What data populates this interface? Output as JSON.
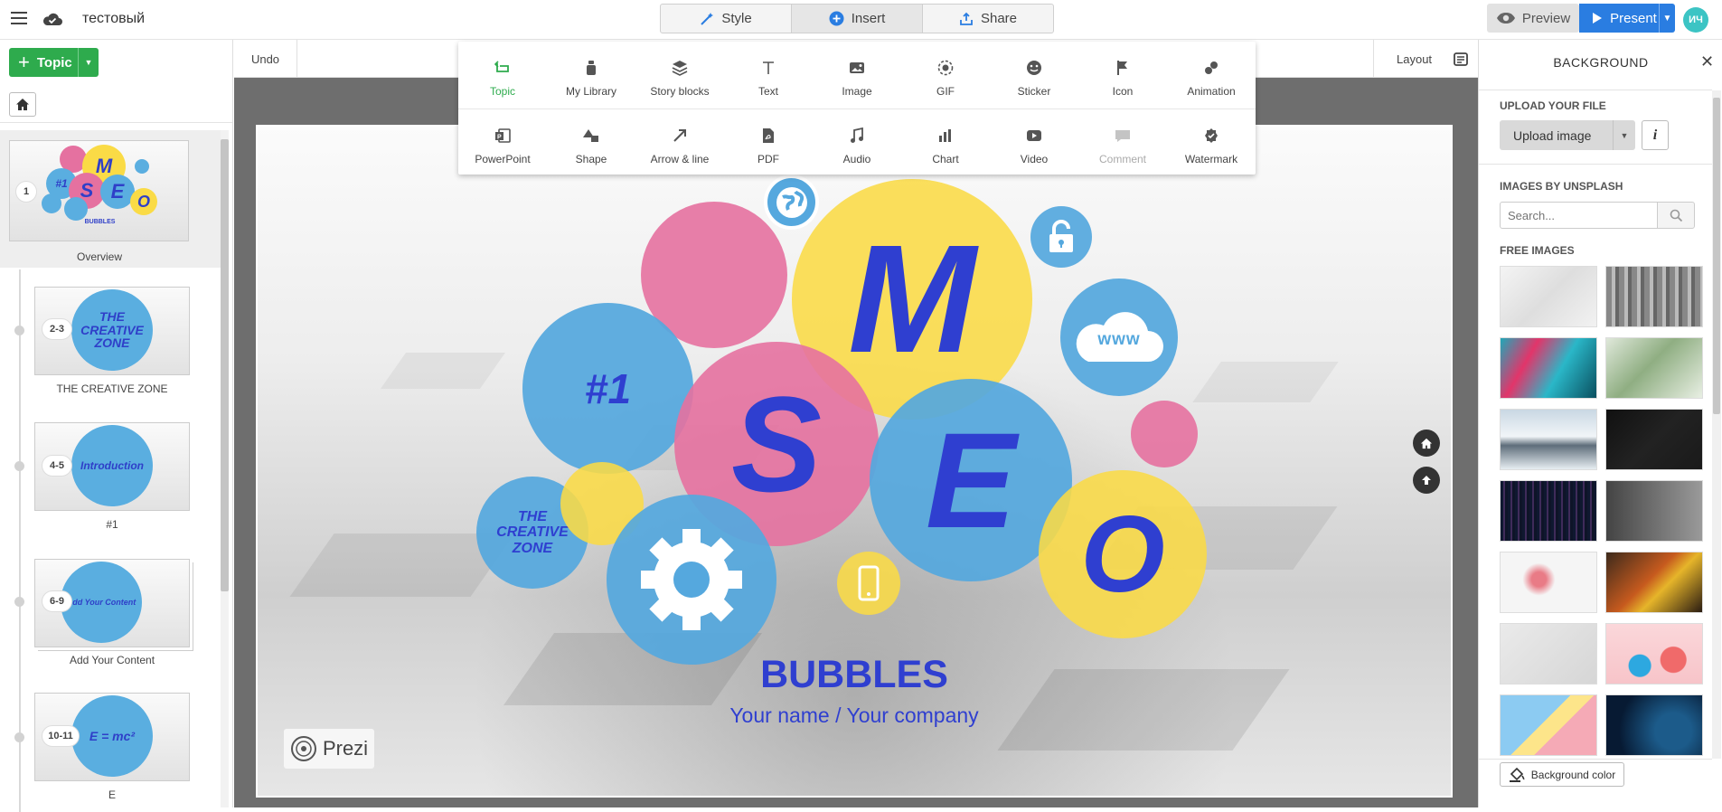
{
  "header": {
    "title": "тестовый",
    "modes": [
      {
        "label": "Style",
        "icon": "wand-icon"
      },
      {
        "label": "Insert",
        "icon": "plus-circle-icon"
      },
      {
        "label": "Share",
        "icon": "share-icon"
      }
    ],
    "preview_label": "Preview",
    "present_label": "Present",
    "avatar_initials": "ИЧ"
  },
  "left_panel": {
    "topic_label": "Topic",
    "slides": [
      {
        "num": "1",
        "label": "Overview"
      },
      {
        "num": "2-3",
        "label": "THE CREATIVE ZONE",
        "thumb_text": "THE CREATIVE ZONE"
      },
      {
        "num": "4-5",
        "label": "#1",
        "thumb_text": "Introduction"
      },
      {
        "num": "6-9",
        "label": "Add Your Content",
        "thumb_text": "Add Your Content"
      },
      {
        "num": "10-11",
        "label": "E",
        "thumb_text": "E = mc²"
      }
    ]
  },
  "toolbar": {
    "undo_label": "Undo",
    "layout_label": "Layout"
  },
  "insert_menu": {
    "row1": [
      {
        "label": "Topic",
        "icon": "topic-icon",
        "state": "active"
      },
      {
        "label": "My Library",
        "icon": "library-icon"
      },
      {
        "label": "Story blocks",
        "icon": "layers-icon"
      },
      {
        "label": "Text",
        "icon": "text-icon"
      },
      {
        "label": "Image",
        "icon": "image-icon"
      },
      {
        "label": "GIF",
        "icon": "gif-icon"
      },
      {
        "label": "Sticker",
        "icon": "sticker-icon"
      },
      {
        "label": "Icon",
        "icon": "flag-icon"
      },
      {
        "label": "Animation",
        "icon": "animation-icon"
      }
    ],
    "row2": [
      {
        "label": "PowerPoint",
        "icon": "powerpoint-icon"
      },
      {
        "label": "Shape",
        "icon": "shape-icon"
      },
      {
        "label": "Arrow & line",
        "icon": "arrow-icon"
      },
      {
        "label": "PDF",
        "icon": "pdf-icon"
      },
      {
        "label": "Audio",
        "icon": "audio-icon"
      },
      {
        "label": "Chart",
        "icon": "chart-icon"
      },
      {
        "label": "Video",
        "icon": "video-icon"
      },
      {
        "label": "Comment",
        "icon": "comment-icon",
        "state": "disabled"
      },
      {
        "label": "Watermark",
        "icon": "watermark-icon"
      }
    ]
  },
  "slide": {
    "letters": {
      "m": "M",
      "s": "S",
      "e": "E",
      "o": "O"
    },
    "hash": "#1",
    "creative_zone": "THE CREATIVE ZONE",
    "www": "www",
    "title": "BUBBLES",
    "subtitle": "Your name / Your company",
    "logo": "Prezi"
  },
  "right_panel": {
    "title": "BACKGROUND",
    "upload_heading": "UPLOAD YOUR FILE",
    "upload_label": "Upload image",
    "info_label": "i",
    "unsplash_heading": "IMAGES BY UNSPLASH",
    "search_placeholder": "Search...",
    "free_heading": "FREE IMAGES",
    "bg_color_label": "Background color"
  },
  "colors": {
    "accent_green": "#2eab4d",
    "present_blue": "#2a7de1",
    "bubble_blue": "#55a8de",
    "bubble_pink": "#e571a0",
    "bubble_yellow": "#fadb46",
    "letter_blue": "#2f3fd0"
  }
}
